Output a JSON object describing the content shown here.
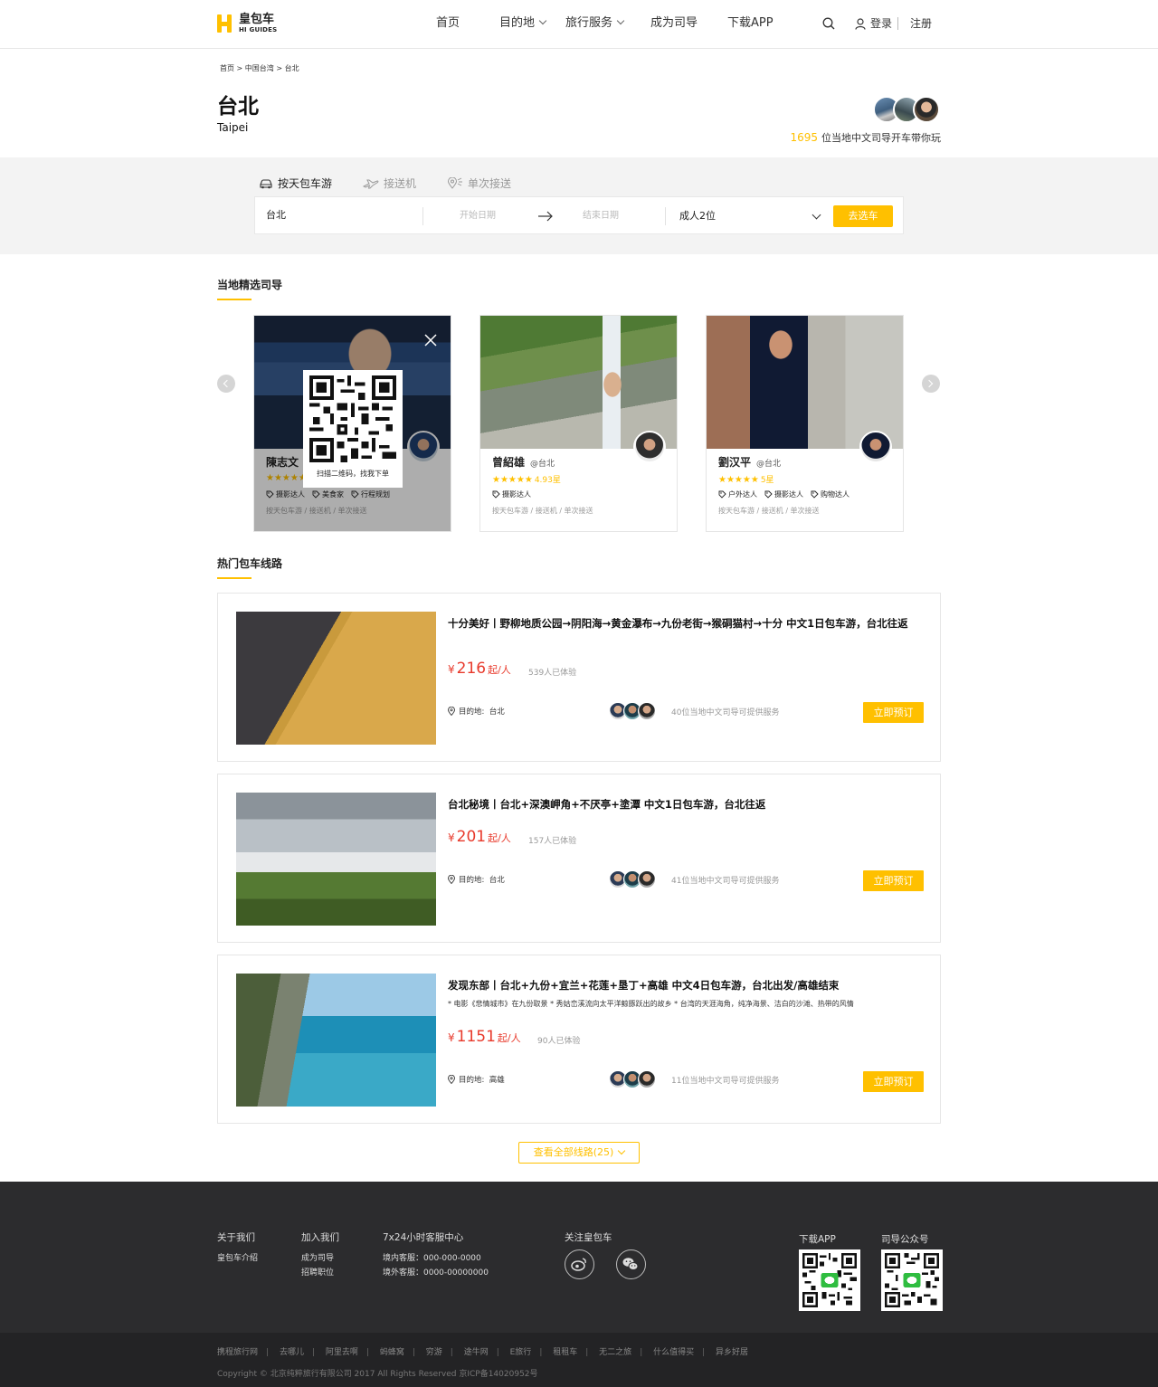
{
  "header": {
    "logo_cn": "皇包车",
    "logo_en": "HI GUIDES",
    "nav": [
      "首页",
      "目的地",
      "旅行服务",
      "成为司导",
      "下载APP"
    ],
    "login": "登录",
    "register": "注册"
  },
  "breadcrumb": "首页 > 中国台湾 > 台北",
  "city": {
    "name_cn": "台北",
    "name_en": "Taipei"
  },
  "guides_summary": {
    "count": "1695",
    "text": "位当地中文司导开车带你玩"
  },
  "search": {
    "tabs": [
      "按天包车游",
      "接送机",
      "单次接送"
    ],
    "city": "台北",
    "start_date": "开始日期",
    "end_date": "结束日期",
    "people": "成人2位",
    "button": "去选车"
  },
  "guides_section_title": "当地精选司导",
  "guides": [
    {
      "name": "陳志文",
      "location": "",
      "stars": "★★★★★",
      "rating": "",
      "tags": [
        "摄影达人",
        "美食家",
        "行程规划"
      ],
      "services": "按天包车游 / 接送机 / 单次接送",
      "qr_caption": "扫描二维码，找我下单"
    },
    {
      "name": "曾紹雄",
      "location": "@台北",
      "stars": "★★★★★",
      "rating": "4.93星",
      "tags": [
        "摄影达人"
      ],
      "services": "按天包车游 / 接送机 / 单次接送"
    },
    {
      "name": "劉汉平",
      "location": "@台北",
      "stars": "★★★★★",
      "rating": "5星",
      "tags": [
        "户外达人",
        "摄影达人",
        "购物达人"
      ],
      "services": "按天包车游 / 接送机 / 单次接送"
    }
  ],
  "routes_section_title": "热门包车线路",
  "routes": [
    {
      "title": "十分美好丨野柳地质公园→阴阳海→黄金瀑布→九份老街→猴硐猫村→十分 中文1日包车游，台北往返",
      "desc": "",
      "currency": "¥",
      "price": "216",
      "unit": "起/人",
      "experienced": "539人已体验",
      "dest_label": "目的地:",
      "dest": "台北",
      "guides": "40位当地中文司导可提供服务",
      "button": "立即预订"
    },
    {
      "title": "台北秘境丨台北+深澳岬角+不厌亭+塗潭 中文1日包车游，台北往返",
      "desc": "",
      "currency": "¥",
      "price": "201",
      "unit": "起/人",
      "experienced": "157人已体验",
      "dest_label": "目的地:",
      "dest": "台北",
      "guides": "41位当地中文司导可提供服务",
      "button": "立即预订"
    },
    {
      "title": "发现东部丨台北+九份+宜兰+花莲+垦丁+高雄 中文4日包车游，台北出发/高雄结束",
      "desc": "* 电影《悲情城市》在九份取景 * 秀姑峦溪流向太平洋鲸豚跃出的故乡 * 台湾的天涯海角，纯净海景、洁白的沙滩、热带的风情",
      "currency": "¥",
      "price": "1151",
      "unit": "起/人",
      "experienced": "90人已体验",
      "dest_label": "目的地:",
      "dest": "高雄",
      "guides": "11位当地中文司导可提供服务",
      "button": "立即预订"
    }
  ],
  "view_all": "查看全部线路(25)",
  "footer": {
    "about": {
      "title": "关于我们",
      "items": [
        "皇包车介绍"
      ]
    },
    "join": {
      "title": "加入我们",
      "items": [
        "成为司导",
        "招聘职位"
      ]
    },
    "service": {
      "title": "7x24小时客服中心",
      "items": [
        "境内客服：000-000-0000",
        "境外客服：0000-00000000"
      ]
    },
    "follow": {
      "title": "关注皇包车"
    },
    "app": {
      "title": "下载APP"
    },
    "official": {
      "title": "司导公众号"
    },
    "links": [
      "携程旅行网",
      "去哪儿",
      "阿里去啊",
      "蚂蜂窝",
      "穷游",
      "途牛网",
      "E旅行",
      "租租车",
      "无二之旅",
      "什么值得买",
      "异乡好居"
    ],
    "copyright": "Copyright © 北京纯粹旅行有限公司 2017 All Rights Reserved 京ICP备14020952号"
  },
  "colors": {
    "accent": "#ffc000",
    "price": "#e83a2c",
    "footer_bg": "#2c2c2e"
  }
}
